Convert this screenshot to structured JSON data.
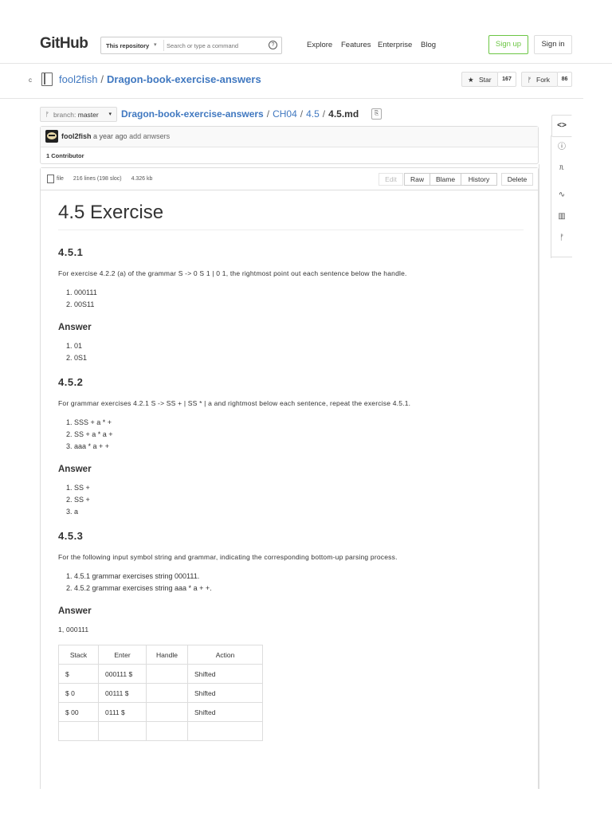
{
  "header": {
    "logo": "GitHub",
    "search_scope": "This repository",
    "search_placeholder": "Search or type a command",
    "nav": [
      "Explore",
      "Features",
      "Enterprise",
      "Blog"
    ],
    "sign_up": "Sign up",
    "sign_in": "Sign in"
  },
  "repo": {
    "edge_char": "c",
    "owner": "fool2fish",
    "name": "Dragon-book-exercise-answers",
    "star_label": "Star",
    "star_count": "167",
    "fork_label": "Fork",
    "fork_count": "86"
  },
  "breadcrumb": {
    "branch_label": "branch:",
    "branch_name": "master",
    "root": "Dragon-book-exercise-answers",
    "parts": [
      "CH04",
      "4.5"
    ],
    "file": "4.5.md"
  },
  "commit": {
    "author": "fool2fish",
    "time": "a year ago",
    "message": "add anwsers",
    "contributors": "1 Contributor"
  },
  "file": {
    "type": "file",
    "lines": "216 lines (198 sloc)",
    "size": "4.326 kb",
    "buttons": [
      "Edit",
      "Raw",
      "Blame",
      "History",
      "Delete"
    ]
  },
  "content": {
    "title": "4.5 Exercise",
    "s1": {
      "heading": "4.5.1",
      "text": "For exercise 4.2.2 (a) of the grammar S -> 0 S 1 | 0 1, the rightmost point out each sentence below the handle.",
      "items": [
        "000111",
        "00S11"
      ],
      "answer_heading": "Answer",
      "answers": [
        "01",
        "0S1"
      ]
    },
    "s2": {
      "heading": "4.5.2",
      "text": "For grammar exercises 4.2.1 S -> SS + | SS * | a and rightmost below each sentence, repeat the exercise 4.5.1.",
      "items": [
        "SSS + a * +",
        "SS + a * a +",
        "aaa * a + +"
      ],
      "answer_heading": "Answer",
      "answers": [
        "SS +",
        "SS +",
        "a"
      ]
    },
    "s3": {
      "heading": "4.5.3",
      "text": "For the following input symbol string and grammar, indicating the corresponding bottom-up parsing process.",
      "items": [
        "4.5.1 grammar exercises string 000111.",
        "4.5.2 grammar exercises string aaa * a + +."
      ],
      "answer_heading": "Answer",
      "answer_line": "1, 000111",
      "table": {
        "headers": [
          "Stack",
          "Enter",
          "Handle",
          "Action"
        ],
        "rows": [
          [
            "$",
            "000111 $",
            "",
            "Shifted"
          ],
          [
            "$ 0",
            "00111 $",
            "",
            "Shifted"
          ],
          [
            "$ 00",
            "0111 $",
            "",
            "Shifted"
          ],
          [
            "",
            "",
            "",
            ""
          ]
        ]
      }
    }
  },
  "sidebar": [
    "code-icon",
    "issues-icon",
    "pull-request-icon",
    "pulse-icon",
    "graphs-icon",
    "network-icon"
  ]
}
